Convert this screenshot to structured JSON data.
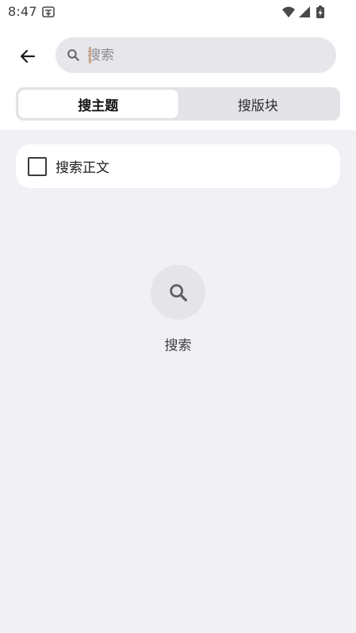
{
  "status_bar": {
    "time": "8:47",
    "icons": [
      "notification-icon",
      "wifi-icon",
      "cellular-signal-icon",
      "battery-charging-icon"
    ]
  },
  "header": {
    "back_icon": "arrow-left-icon",
    "search": {
      "placeholder": "搜索",
      "value": "",
      "icon": "search-icon"
    }
  },
  "tabs": [
    {
      "label": "搜主题",
      "active": true
    },
    {
      "label": "搜版块",
      "active": false
    }
  ],
  "options": {
    "search_body": {
      "label": "搜索正文",
      "checked": false
    }
  },
  "empty_state": {
    "icon": "search-icon",
    "label": "搜索"
  },
  "colors": {
    "background": "#f1f0f5",
    "surface": "#ffffff",
    "search_field": "#e7e6eb",
    "tab_track": "#e4e3e8"
  }
}
